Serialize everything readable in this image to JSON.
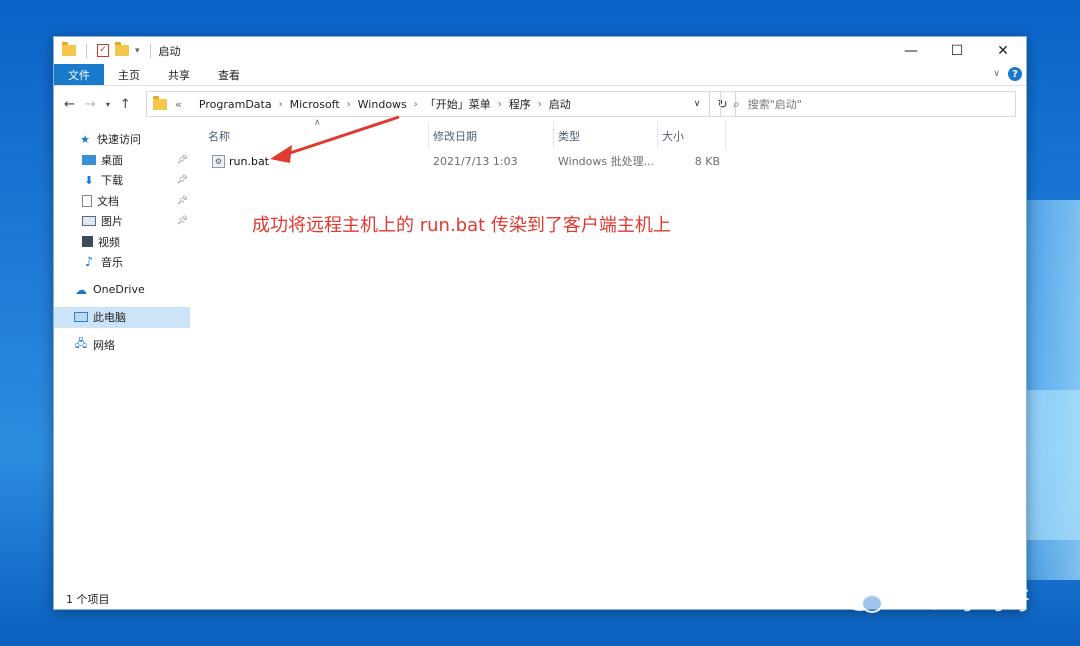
{
  "window": {
    "title": "启动",
    "controls": {
      "minimize": "—",
      "maximize": "☐",
      "close": "✕"
    }
  },
  "ribbon": {
    "tabs": [
      "文件",
      "主页",
      "共享",
      "查看"
    ]
  },
  "address": {
    "prefix": "«",
    "crumbs": [
      "ProgramData",
      "Microsoft",
      "Windows",
      "「开始」菜单",
      "程序",
      "启动"
    ]
  },
  "search": {
    "placeholder": "搜索\"启动\""
  },
  "nav": {
    "quick_access": "快速访问",
    "items": [
      {
        "label": "桌面",
        "icon": "desktop-icon",
        "pinned": true
      },
      {
        "label": "下载",
        "icon": "download-icon",
        "pinned": true
      },
      {
        "label": "文档",
        "icon": "document-icon",
        "pinned": true
      },
      {
        "label": "图片",
        "icon": "picture-icon",
        "pinned": true
      },
      {
        "label": "视频",
        "icon": "video-icon",
        "pinned": false
      },
      {
        "label": "音乐",
        "icon": "music-icon",
        "pinned": false
      }
    ],
    "onedrive": "OneDrive",
    "this_pc": "此电脑",
    "network": "网络"
  },
  "columns": {
    "name": "名称",
    "modified": "修改日期",
    "type": "类型",
    "size": "大小"
  },
  "files": [
    {
      "name": "run.bat",
      "modified": "2021/7/13 1:03",
      "type": "Windows 批处理...",
      "size": "8 KB"
    }
  ],
  "annotation": "成功将远程主机上的 run.bat 传染到了客户端主机上",
  "status": {
    "count": "1 个项目"
  },
  "watermark": "HACK学习呀",
  "colors": {
    "accent": "#1979ca",
    "annotation": "#e03a30",
    "selected": "#cce4f7"
  }
}
